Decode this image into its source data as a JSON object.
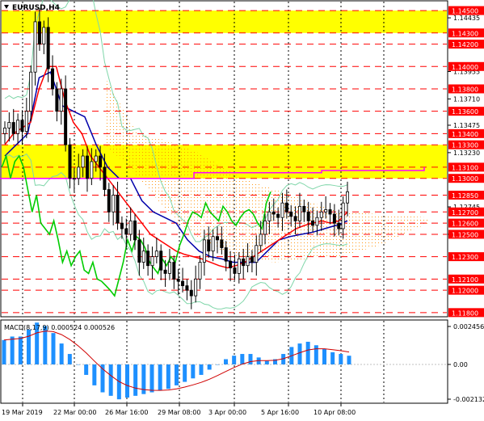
{
  "symbol": "EURUSD,H4",
  "macd_label": "MACD(8,17,9) 0.000524 0.000526",
  "colors": {
    "background": "#ffffff",
    "resistance_zone": "#ffff00",
    "level_line": "#ff0000",
    "candle": "#000000",
    "tenkan": "#ff0000",
    "kijun": "#0000aa",
    "chikou": "#00cc00",
    "senkou": "#ff00ff",
    "kumo": "#ff8c00",
    "bollinger": "#7fd6a9",
    "macd_hist": "#1e90ff",
    "macd_signal": "#d00000",
    "label_bg": "#ff0000",
    "label_text": "#ffffff"
  },
  "price_axis": {
    "min": 1.1177,
    "max": 1.1458,
    "levels": [
      {
        "price": 1.145,
        "text": "1.14500"
      },
      {
        "price": 1.143,
        "text": "1.14300"
      },
      {
        "price": 1.142,
        "text": "1.14200"
      },
      {
        "price": 1.14,
        "text": "1.14000"
      },
      {
        "price": 1.138,
        "text": "1.13800"
      },
      {
        "price": 1.136,
        "text": "1.13600"
      },
      {
        "price": 1.134,
        "text": "1.13400"
      },
      {
        "price": 1.133,
        "text": "1.13300"
      },
      {
        "price": 1.131,
        "text": "1.13100"
      },
      {
        "price": 1.13,
        "text": "1.13000"
      },
      {
        "price": 1.1285,
        "text": "1.12850"
      },
      {
        "price": 1.127,
        "text": "1.12700"
      },
      {
        "price": 1.126,
        "text": "1.12600"
      },
      {
        "price": 1.125,
        "text": "1.12500"
      },
      {
        "price": 1.123,
        "text": "1.12300"
      },
      {
        "price": 1.121,
        "text": "1.12100"
      },
      {
        "price": 1.12,
        "text": "1.12000"
      },
      {
        "price": 1.118,
        "text": "1.11800"
      }
    ],
    "ticks": [
      {
        "price": 1.14435,
        "text": "1.14435"
      },
      {
        "price": 1.13955,
        "text": "1.13955"
      },
      {
        "price": 1.1371,
        "text": "1.13710"
      },
      {
        "price": 1.13475,
        "text": "1.13475"
      },
      {
        "price": 1.1323,
        "text": "1.13230"
      },
      {
        "price": 1.12745,
        "text": "1.12745"
      },
      {
        "price": 1.125,
        "text": "1.12500"
      }
    ]
  },
  "zones": [
    {
      "from": 1.143,
      "to": 1.145
    },
    {
      "from": 1.13,
      "to": 1.133
    }
  ],
  "time_axis": [
    "19 Mar 2019",
    "22 Mar 00:00",
    "26 Mar 16:00",
    "29 Mar 08:00",
    "3 Apr 00:00",
    "5 Apr 16:00",
    "10 Apr 08:00"
  ],
  "chart_data": {
    "type": "candlestick",
    "symbol": "EURUSD",
    "timeframe": "H4",
    "close": [
      1.1345,
      1.135,
      1.134,
      1.1352,
      1.1342,
      1.136,
      1.1395,
      1.144,
      1.142,
      1.1435,
      1.1398,
      1.138,
      1.136,
      1.138,
      1.133,
      1.13,
      1.13,
      1.131,
      1.132,
      1.13,
      1.1315,
      1.132,
      1.131,
      1.129,
      1.127,
      1.1285,
      1.126,
      1.1255,
      1.125,
      1.1262,
      1.1245,
      1.1225,
      1.1235,
      1.1222,
      1.123,
      1.1235,
      1.1218,
      1.1215,
      1.1225,
      1.121,
      1.1208,
      1.1204,
      1.12,
      1.1195,
      1.121,
      1.1225,
      1.1245,
      1.1235,
      1.1248,
      1.1245,
      1.1238,
      1.1226,
      1.122,
      1.1215,
      1.1228,
      1.1222,
      1.123,
      1.1225,
      1.124,
      1.125,
      1.1262,
      1.127,
      1.1268,
      1.1265,
      1.1278,
      1.127,
      1.1266,
      1.1262,
      1.1275,
      1.127,
      1.1262,
      1.1258,
      1.1265,
      1.127,
      1.1272,
      1.1268,
      1.126,
      1.1255,
      1.1278,
      1.1288
    ],
    "tenkan": [
      1.133,
      1.134,
      1.1345,
      1.135,
      1.138,
      1.14,
      1.14,
      1.137,
      1.135,
      1.134,
      1.132,
      1.131,
      1.13,
      1.129,
      1.128,
      1.127,
      1.126,
      1.125,
      1.1245,
      1.124,
      1.1235,
      1.1232,
      1.123,
      1.1228,
      1.1225,
      1.1222,
      1.122,
      1.1222,
      1.1225,
      1.123,
      1.1235,
      1.124,
      1.1245,
      1.125,
      1.1255,
      1.1258,
      1.126,
      1.1262,
      1.126,
      1.1262,
      1.127
    ],
    "kijun": [
      1.132,
      1.133,
      1.134,
      1.139,
      1.1395,
      1.1365,
      1.136,
      1.1355,
      1.133,
      1.131,
      1.13,
      1.13,
      1.128,
      1.127,
      1.1265,
      1.126,
      1.1245,
      1.1235,
      1.123,
      1.1228,
      1.1225,
      1.1225,
      1.1225,
      1.1235,
      1.1245,
      1.1248,
      1.125,
      1.1252,
      1.1255,
      1.1258,
      1.1262
    ],
    "senkou_b": [
      1.13,
      1.13,
      1.13,
      1.1305,
      1.1305,
      1.1307,
      1.131
    ],
    "macd_hist": [
      0.0014,
      0.0016,
      0.0016,
      0.002,
      0.0024,
      0.0022,
      0.0018,
      0.0012,
      0.0006,
      0.0,
      -0.0006,
      -0.0012,
      -0.0016,
      -0.0018,
      -0.002,
      -0.0019,
      -0.0018,
      -0.0017,
      -0.0016,
      -0.0015,
      -0.0014,
      -0.0012,
      -0.001,
      -0.0008,
      -0.0006,
      -0.0003,
      0.0,
      0.0003,
      0.0005,
      0.0006,
      0.0006,
      0.0004,
      0.0002,
      0.0003,
      0.0006,
      0.001,
      0.0012,
      0.0013,
      0.0011,
      0.0009,
      0.0007,
      0.0006,
      0.0005
    ],
    "macd_axis": {
      "min": -0.002132,
      "max": 0.002456,
      "ticks": [
        {
          "value": 0.002456,
          "text": "0.002456"
        },
        {
          "value": 0.0,
          "text": "0.00"
        },
        {
          "value": -0.002132,
          "text": "-0.002132"
        }
      ]
    }
  }
}
